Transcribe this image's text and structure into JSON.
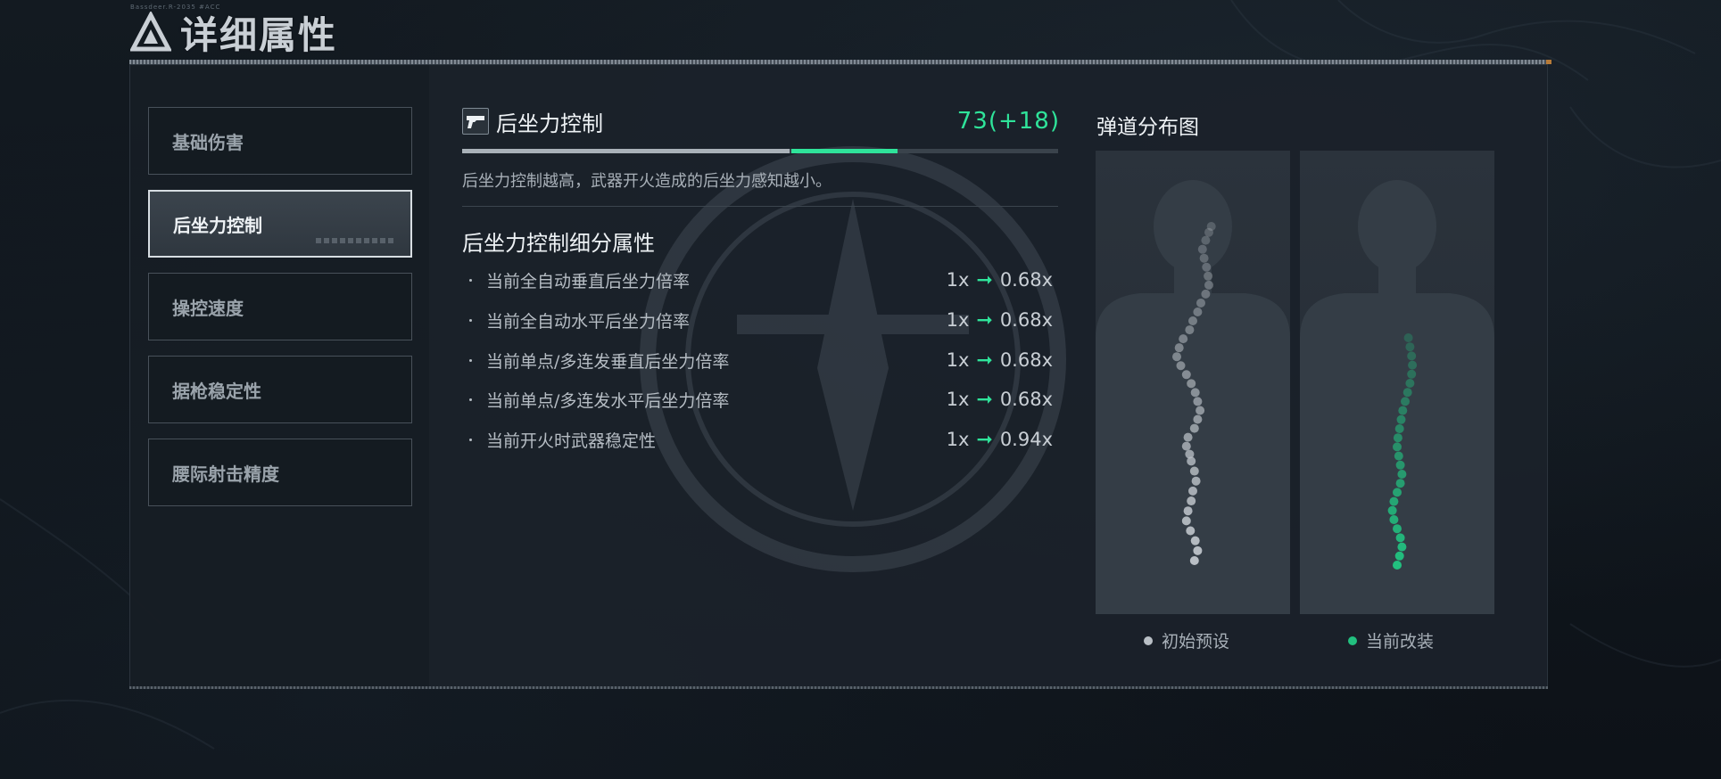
{
  "header": {
    "title": "详细属性",
    "tiny_text": "Bassdeer.R-2035 #ACC"
  },
  "sidebar": {
    "items": [
      {
        "label": "基础伤害"
      },
      {
        "label": "后坐力控制"
      },
      {
        "label": "操控速度"
      },
      {
        "label": "据枪稳定性"
      },
      {
        "label": "腰际射击精度"
      }
    ]
  },
  "stat": {
    "name": "后坐力控制",
    "value_text": "73(+18)",
    "base": 73,
    "bonus": 18,
    "max": 100,
    "description": "后坐力控制越高，武器开火造成的后坐力感知越小。"
  },
  "sub_attributes": {
    "title": "后坐力控制细分属性",
    "rows": [
      {
        "label": "当前全自动垂直后坐力倍率",
        "from": "1x",
        "to": "0.68x"
      },
      {
        "label": "当前全自动水平后坐力倍率",
        "from": "1x",
        "to": "0.68x"
      },
      {
        "label": "当前单点/多连发垂直后坐力倍率",
        "from": "1x",
        "to": "0.68x"
      },
      {
        "label": "当前单点/多连发水平后坐力倍率",
        "from": "1x",
        "to": "0.68x"
      },
      {
        "label": "当前开火时武器稳定性",
        "from": "1x",
        "to": "0.94x"
      }
    ]
  },
  "spread": {
    "title": "弹道分布图",
    "legend": [
      {
        "label": "初始预设",
        "color": "#b9bfc5"
      },
      {
        "label": "当前改装",
        "color": "#22c07f"
      }
    ]
  },
  "colors": {
    "accent_green": "#2fe39a",
    "bar_base": "#a9b1b8",
    "background": "#0f151b"
  },
  "chart_data": [
    {
      "type": "scatter",
      "name": "初始预设",
      "x": [
        0.2,
        0.6,
        0.3,
        -0.3,
        -0.8,
        -0.6,
        -0.2,
        0.0,
        0.4,
        0.2,
        -0.2,
        -0.4,
        -0.8,
        -0.6,
        0.2,
        0.6,
        0.9,
        0.6,
        0.3,
        -0.2,
        -0.8,
        -1.5,
        -2.0,
        -1.7,
        -1.2,
        -0.4,
        0.0,
        0.6,
        1.0,
        1.6,
        2.0,
        1.9,
        1.7,
        1.4,
        1.2,
        1.6,
        2.0,
        2.3
      ],
      "y": [
        0.0,
        1.0,
        2.0,
        3.0,
        4.0,
        5.0,
        6.0,
        7.0,
        8.0,
        9.0,
        10.0,
        10.7,
        11.5,
        12.4,
        13.3,
        14.2,
        15.1,
        16.0,
        16.9,
        17.8,
        18.7,
        19.6,
        20.5,
        21.4,
        22.3,
        23.2,
        24.1,
        25.0,
        25.9,
        26.8,
        27.7,
        28.6,
        29.5,
        30.4,
        31.3,
        32.2,
        33.0,
        33.6
      ]
    },
    {
      "type": "scatter",
      "name": "当前改装",
      "x": [
        0.0,
        0.3,
        0.6,
        0.4,
        0.0,
        -0.4,
        -0.6,
        -0.4,
        0.0,
        0.4,
        0.6,
        0.4,
        0.2,
        0.0,
        0.1,
        0.3,
        0.5,
        0.7,
        1.0,
        1.3,
        1.6,
        1.8,
        1.9,
        1.8,
        1.6,
        1.4
      ],
      "y": [
        0.0,
        1.0,
        2.0,
        3.0,
        4.0,
        5.0,
        6.0,
        7.0,
        8.0,
        9.0,
        10.0,
        11.0,
        12.0,
        13.0,
        14.0,
        15.0,
        16.0,
        17.0,
        18.0,
        19.0,
        20.0,
        21.0,
        22.0,
        23.0,
        24.0,
        25.0
      ]
    }
  ]
}
